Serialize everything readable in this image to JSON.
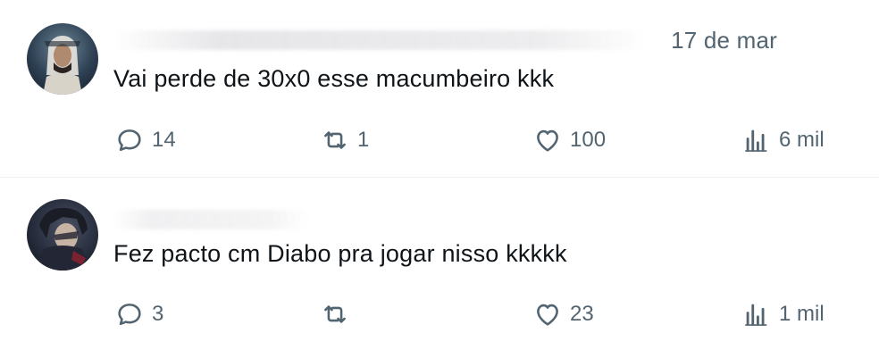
{
  "tweets": [
    {
      "date": "17 de mar",
      "text": "Vai perde de 30x0 esse macumbeiro kkk",
      "replies": "14",
      "retweets": "1",
      "likes": "100",
      "views": "6 mil"
    },
    {
      "date": "",
      "text": "Fez pacto cm Diabo pra jogar nisso kkkkk",
      "replies": "3",
      "retweets": "",
      "likes": "23",
      "views": "1 mil"
    }
  ],
  "icons": {
    "reply": "reply-icon",
    "retweet": "retweet-icon",
    "like": "heart-icon",
    "views": "views-icon"
  },
  "colors": {
    "text": "#0f1419",
    "muted": "#536471",
    "divider": "#eff3f4"
  }
}
